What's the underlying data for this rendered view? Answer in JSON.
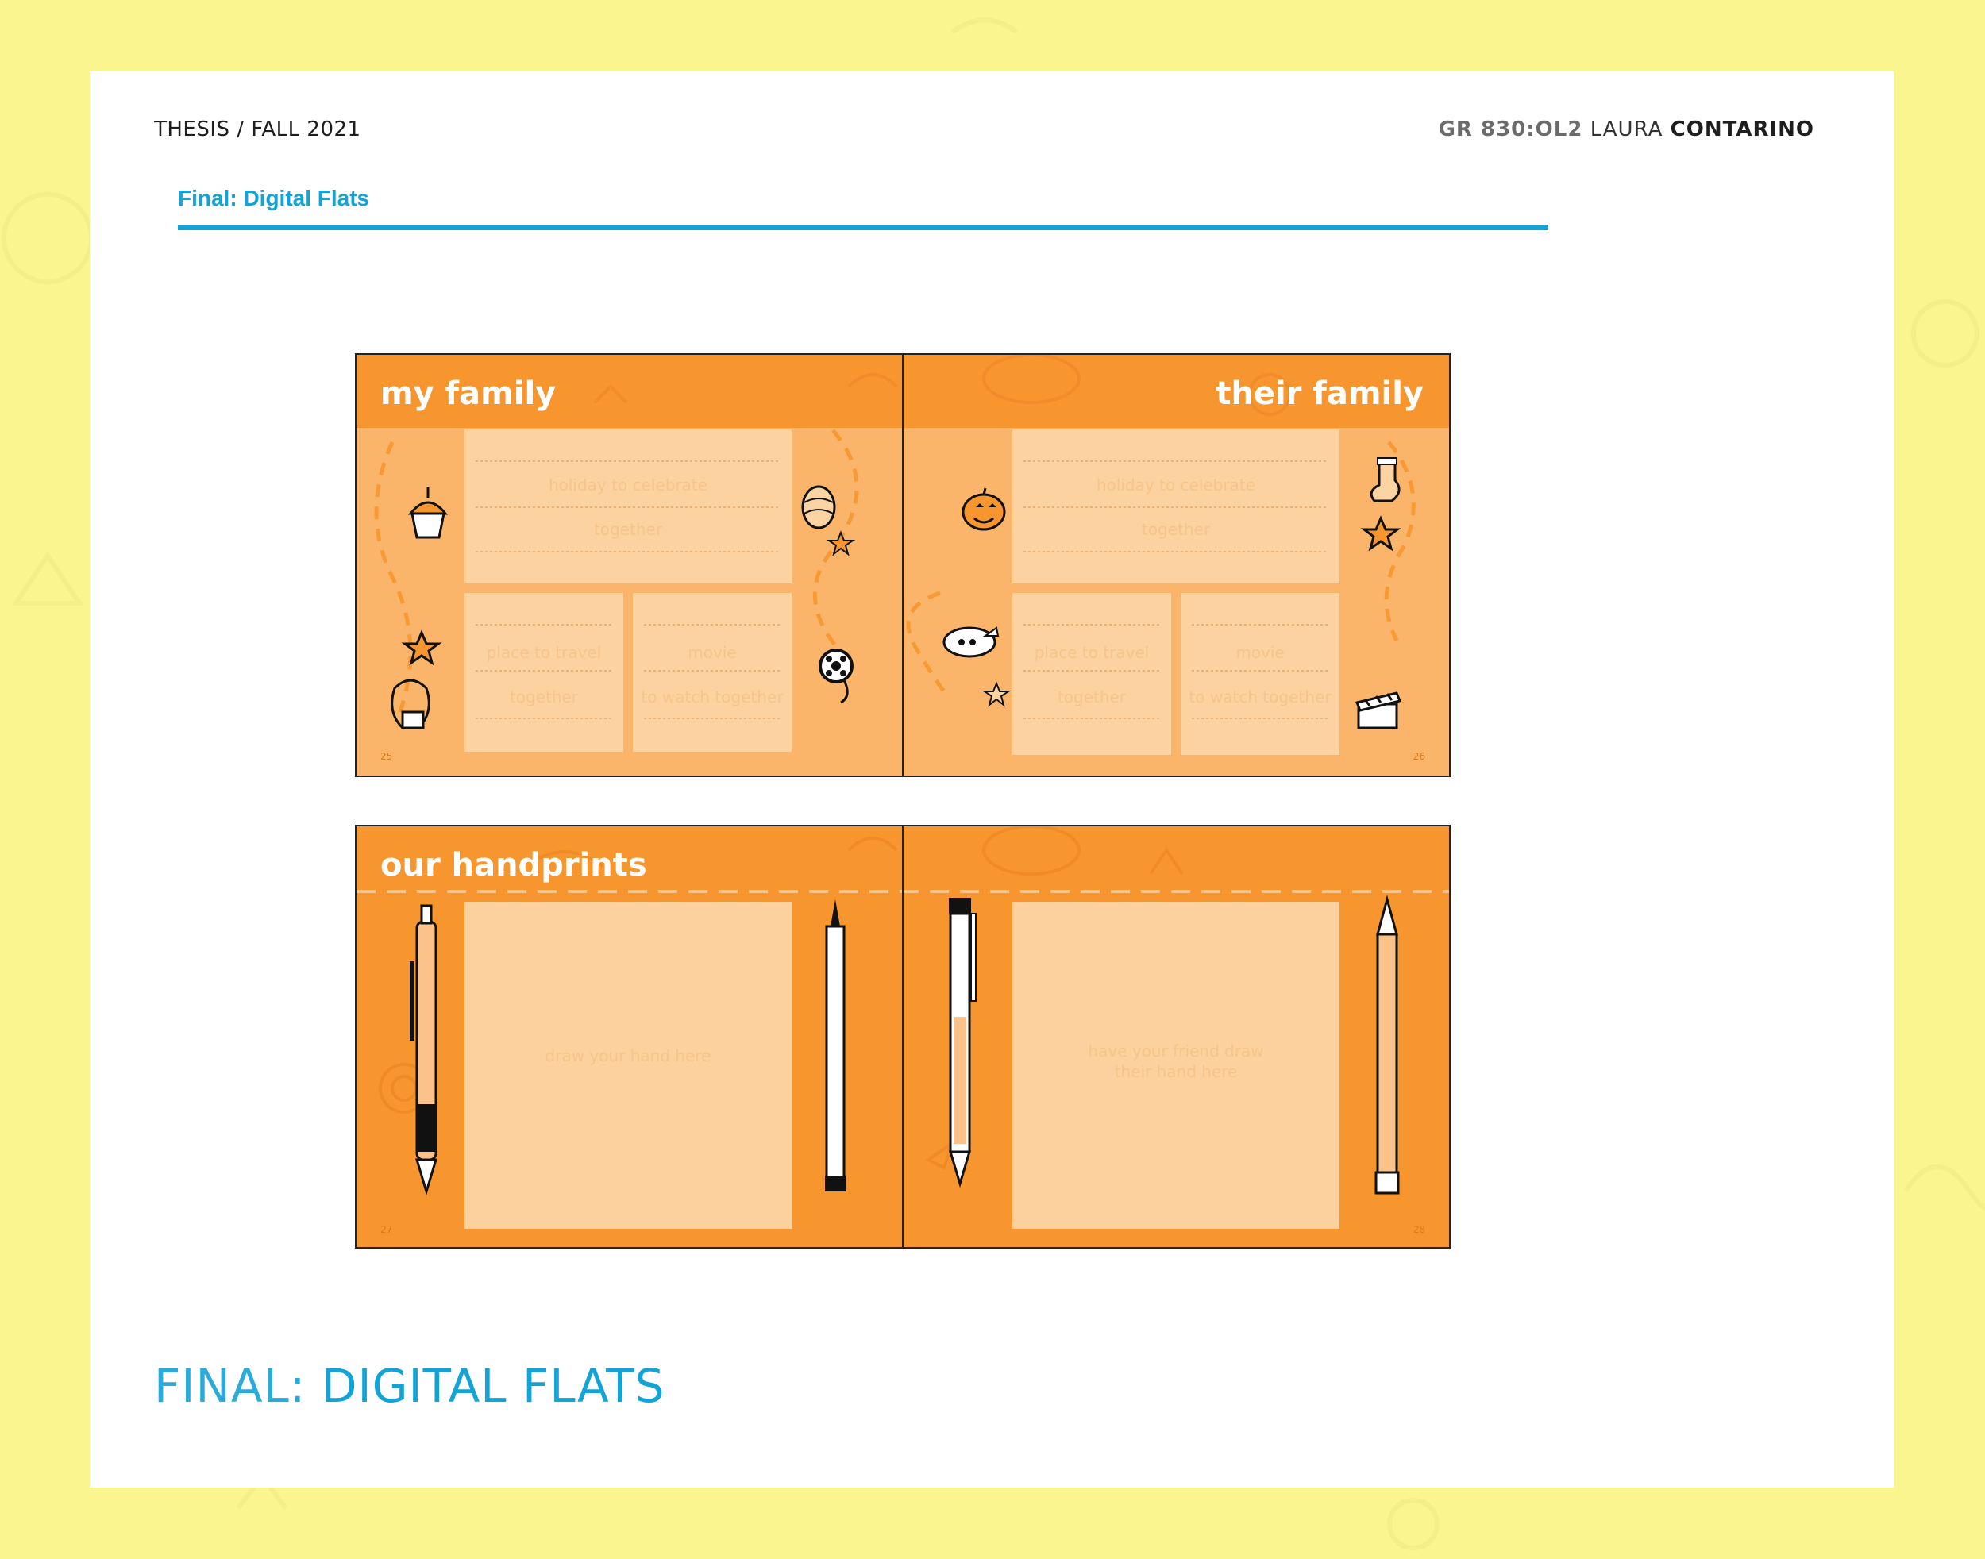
{
  "header": {
    "left": "THESIS / FALL 2021",
    "course_code": "GR 830:OL2",
    "author_first": "LAURA",
    "author_last": "CONTARINO"
  },
  "section": {
    "label": "Final: Digital Flats"
  },
  "spread1": {
    "left_title": "my family",
    "right_title": "their family",
    "left_page_number": "25",
    "right_page_number": "26",
    "left_boxes": {
      "top_line1": "holiday to celebrate",
      "top_line2": "together",
      "bl_line1": "place to travel",
      "bl_line2": "together",
      "br_line1": "movie",
      "br_line2": "to watch together"
    },
    "right_boxes": {
      "top_line1": "holiday to celebrate",
      "top_line2": "together",
      "bl_line1": "place to travel",
      "bl_line2": "together",
      "br_line1": "movie",
      "br_line2": "to watch together"
    },
    "icons": [
      "cupcake-icon",
      "easter-egg-icon",
      "star-icon",
      "film-reel-icon",
      "suitcase-icon",
      "pumpkin-icon",
      "stocking-icon",
      "airplane-icon",
      "clapperboard-icon"
    ]
  },
  "spread2": {
    "title": "our handprints",
    "left_hint": "draw your hand here",
    "right_hint_line1": "have your friend draw",
    "right_hint_line2": "their hand here",
    "left_page_number": "27",
    "right_page_number": "28",
    "icons": [
      "mechanical-pencil-icon",
      "pen-icon",
      "click-pen-icon",
      "pencil-icon"
    ]
  },
  "footer": {
    "title_light": "FINAL:",
    "title_bold": "DIGITAL FLATS"
  },
  "colors": {
    "background": "#faf58f",
    "accent_blue": "#14a3d7",
    "spread_orange": "#f7962f",
    "light_orange": "#fbb56b",
    "panel": "#fcd4a3"
  }
}
